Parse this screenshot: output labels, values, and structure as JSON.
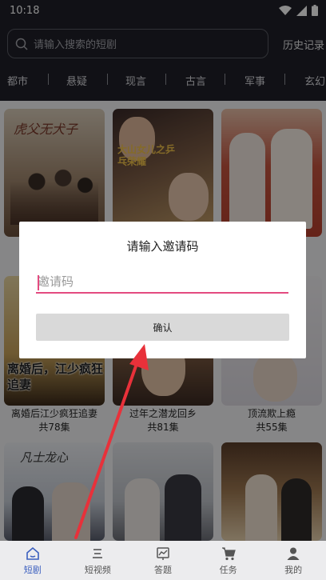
{
  "status": {
    "time": "10:18"
  },
  "search": {
    "placeholder": "请输入搜索的短剧"
  },
  "history_label": "历史记录",
  "categories": [
    "都市",
    "悬疑",
    "现言",
    "古言",
    "军事",
    "玄幻"
  ],
  "cards": [
    {
      "poster_text": "虎父无犬子",
      "caption": "",
      "episodes": ""
    },
    {
      "poster_text": "大山女儿之乒乓荣耀",
      "caption": "",
      "episodes": ""
    },
    {
      "poster_text": "",
      "caption": "",
      "episodes": ""
    },
    {
      "poster_text": "离婚后，江少疯狂追妻",
      "caption": "离婚后江少疯狂追妻",
      "episodes": "共78集"
    },
    {
      "poster_text": "",
      "caption": "过年之潜龙回乡",
      "episodes": "共81集"
    },
    {
      "poster_text": "",
      "caption": "顶流欺上瘾",
      "episodes": "共55集"
    },
    {
      "poster_text": "凡士龙心",
      "caption": "",
      "episodes": ""
    },
    {
      "poster_text": "",
      "caption": "",
      "episodes": ""
    },
    {
      "poster_text": "",
      "caption": "",
      "episodes": ""
    }
  ],
  "dialog": {
    "title": "请输入邀请码",
    "input_placeholder": "邀请码",
    "confirm_label": "确认"
  },
  "nav": [
    {
      "label": "短剧",
      "icon": "home-icon",
      "active": true
    },
    {
      "label": "短视频",
      "icon": "menu-icon",
      "active": false
    },
    {
      "label": "答题",
      "icon": "chart-icon",
      "active": false
    },
    {
      "label": "任务",
      "icon": "cart-icon",
      "active": false
    },
    {
      "label": "我的",
      "icon": "person-icon",
      "active": false
    }
  ],
  "colors": {
    "accent": "#e44b80",
    "nav_active": "#3b5fbf",
    "arrow": "#e8313a"
  }
}
